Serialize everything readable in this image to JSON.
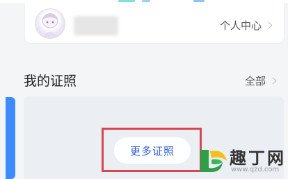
{
  "profile": {
    "center_label": "个人中心"
  },
  "certificates": {
    "section_title": "我的证照",
    "all_label": "全部",
    "more_button_label": "更多证照"
  },
  "watermark": {
    "brand_name": "趣丁网",
    "url": "www.qzd.com"
  },
  "colors": {
    "accent_blue": "#3d8bff",
    "button_text_blue": "#2f5dd8",
    "highlight_red": "#d7474e",
    "card_gray": "#ebeef3"
  },
  "icons": {
    "chevron": "chevron-right-icon",
    "avatar": "anime-girl-avatar",
    "logo": "qzd-leaf-logo"
  }
}
